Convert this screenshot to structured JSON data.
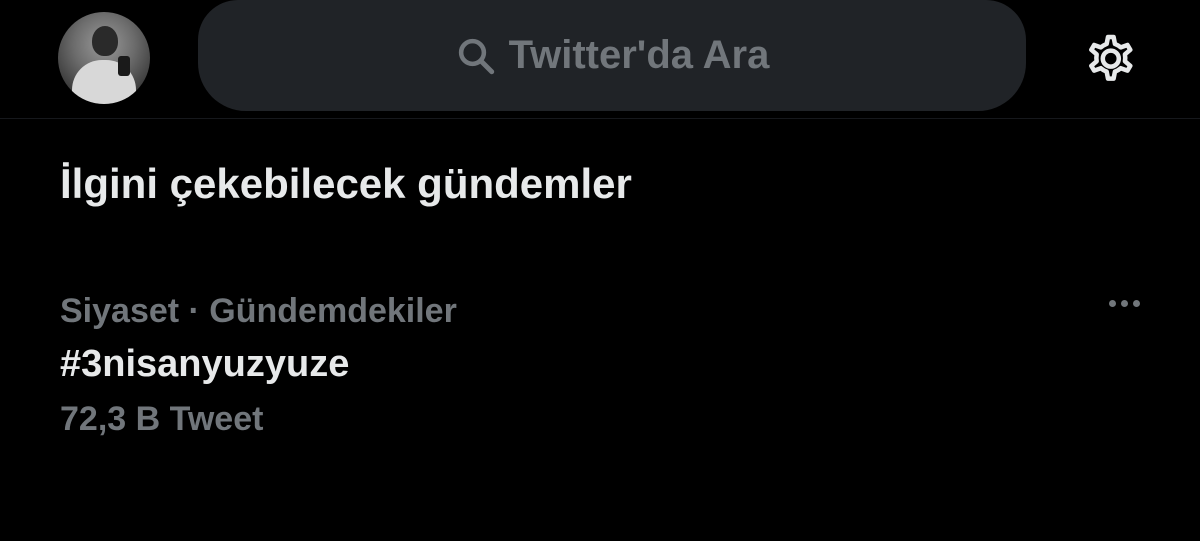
{
  "header": {
    "search_placeholder": "Twitter'da Ara",
    "search_icon": "search-icon",
    "settings_icon": "gear-icon",
    "avatar_icon": "profile-avatar"
  },
  "section": {
    "title": "İlgini çekebilecek gündemler"
  },
  "trends": [
    {
      "category": "Siyaset · Gündemdekiler",
      "name": "#3nisanyuzyuze",
      "count": "72,3 B Tweet",
      "more_icon": "more-options-icon"
    }
  ],
  "colors": {
    "background": "#000000",
    "search_bg": "#202327",
    "primary_text": "#e7e9ea",
    "secondary_text": "#71767b"
  }
}
